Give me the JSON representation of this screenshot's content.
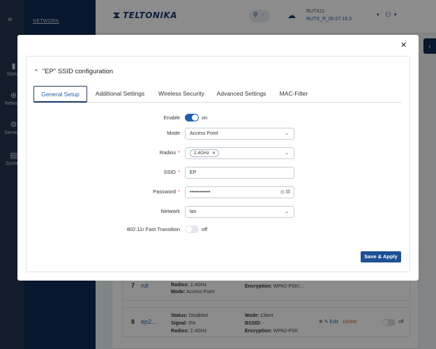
{
  "sidebar": {
    "items": [
      {
        "label": "Status",
        "icon": "signal-bars-icon"
      },
      {
        "label": "Network",
        "icon": "globe-icon"
      },
      {
        "label": "Services",
        "icon": "gear-icon"
      },
      {
        "label": "System",
        "icon": "document-icon"
      }
    ]
  },
  "subnav": {
    "title": "NETWORK"
  },
  "header": {
    "logo": "TELTONIKA",
    "search_shortcut": "/",
    "device_name": "RUTX11",
    "firmware": "RUTX_R_00.07.16.3"
  },
  "background_rows": [
    {
      "num": "7",
      "name": "rut",
      "col1": [
        {
          "k": "Radios:",
          "v": " 2.4GHz"
        },
        {
          "k": "Mode:",
          "v": " Access Point"
        }
      ],
      "col2": [
        {
          "k": "Encryption:",
          "v": " WPA2-PSK/..."
        }
      ]
    },
    {
      "num": "8",
      "name": "ep2...",
      "col1": [
        {
          "k": "Status:",
          "v": " Disabled"
        },
        {
          "k": "Signal:",
          "v": " 0%"
        },
        {
          "k": "Radios:",
          "v": " 2.4GHz"
        }
      ],
      "col2": [
        {
          "k": "Mode:",
          "v": " Client"
        },
        {
          "k": "BSSID:",
          "v": " -"
        },
        {
          "k": "Encryption:",
          "v": " WPA2-PSK"
        }
      ],
      "edit_label": "Edit",
      "delete_label": "Delete",
      "toggle_label": "off"
    }
  ],
  "modal": {
    "title": "\"EP\" SSID configuration",
    "tabs": [
      "General Setup",
      "Additional Settings",
      "Wireless Security",
      "Advanced Settings",
      "MAC-Filter"
    ],
    "active_tab": "General Setup",
    "form": {
      "enable": {
        "label": "Enable",
        "value": "on"
      },
      "mode": {
        "label": "Mode",
        "value": "Access Point"
      },
      "radios": {
        "label": "Radios",
        "chip": "2.4GHz"
      },
      "ssid": {
        "label": "SSID",
        "value": "EP"
      },
      "password": {
        "label": "Password",
        "value": "••••••••••••"
      },
      "network": {
        "label": "Network",
        "value": "lan"
      },
      "fast_transition": {
        "label": "802.11r Fast Transition",
        "value": "off"
      }
    },
    "required_mark": "*",
    "save_label": "Save & Apply"
  },
  "colors": {
    "primary": "#1c4f95",
    "sidebar": "#23344f",
    "subnav": "#0d2a52",
    "required": "#e0452b"
  }
}
